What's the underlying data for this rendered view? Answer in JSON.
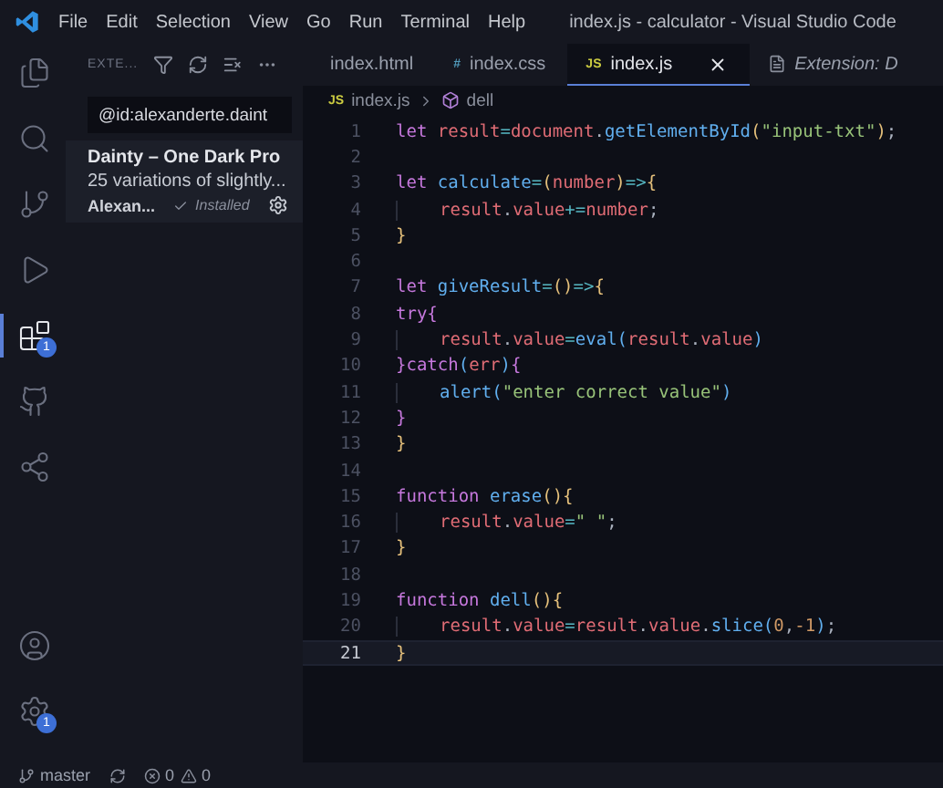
{
  "title_bar": {
    "menu": [
      "File",
      "Edit",
      "Selection",
      "View",
      "Go",
      "Run",
      "Terminal",
      "Help"
    ],
    "title": "index.js - calculator - Visual Studio Code"
  },
  "activity_bar": {
    "items": [
      {
        "kind": "files",
        "selected": false
      },
      {
        "kind": "search",
        "selected": false
      },
      {
        "kind": "source-control",
        "selected": false
      },
      {
        "kind": "run",
        "selected": false
      },
      {
        "kind": "extensions",
        "selected": true,
        "badge": "1"
      },
      {
        "kind": "github",
        "selected": false
      },
      {
        "kind": "remote",
        "selected": false
      }
    ],
    "bottom": [
      {
        "kind": "account"
      },
      {
        "kind": "settings",
        "badge": "1"
      }
    ]
  },
  "sidebar": {
    "header": "EXTE...",
    "search": {
      "value": "@id:alexanderte.daint"
    },
    "extension": {
      "name": "Dainty – One Dark Pro",
      "description": "25 variations of slightly...",
      "author": "Alexan...",
      "status": "Installed"
    }
  },
  "tabs": [
    {
      "label": "index.html",
      "kind": "html",
      "selected": false
    },
    {
      "label": "index.css",
      "kind": "css",
      "icon_text": "#",
      "selected": false
    },
    {
      "label": "index.js",
      "kind": "js",
      "icon_text": "JS",
      "selected": true
    },
    {
      "label": "Extension: D",
      "kind": "preview",
      "selected": false
    }
  ],
  "breadcrumb": {
    "icon_text": "JS",
    "file": "index.js",
    "symbol": "dell"
  },
  "code": [
    {
      "number": "1",
      "current": false,
      "tokens": [
        {
          "kind": "kw",
          "text": "let "
        },
        {
          "kind": "var",
          "text": "result"
        },
        {
          "kind": "op",
          "text": "="
        },
        {
          "kind": "var",
          "text": "document"
        },
        {
          "kind": "plain",
          "text": "."
        },
        {
          "kind": "fn",
          "text": "getElementById"
        },
        {
          "kind": "br",
          "text": "("
        },
        {
          "kind": "str",
          "text": "\"input-txt\""
        },
        {
          "kind": "br",
          "text": ")"
        },
        {
          "kind": "plain",
          "text": ";"
        }
      ]
    },
    {
      "number": "2",
      "current": false
    },
    {
      "number": "3",
      "current": false,
      "tokens": [
        {
          "kind": "kw",
          "text": "let "
        },
        {
          "kind": "fn",
          "text": "calculate"
        },
        {
          "kind": "op",
          "text": "="
        },
        {
          "kind": "br",
          "text": "("
        },
        {
          "kind": "var",
          "text": "number"
        },
        {
          "kind": "br",
          "text": ")"
        },
        {
          "kind": "op",
          "text": "=>"
        },
        {
          "kind": "br",
          "text": "{"
        }
      ]
    },
    {
      "number": "4",
      "indent": true,
      "current": false,
      "tokens": [
        {
          "kind": "var",
          "text": "result"
        },
        {
          "kind": "plain",
          "text": "."
        },
        {
          "kind": "var",
          "text": "value"
        },
        {
          "kind": "op",
          "text": "+="
        },
        {
          "kind": "var",
          "text": "number"
        },
        {
          "kind": "plain",
          "text": ";"
        }
      ]
    },
    {
      "number": "5",
      "current": false,
      "tokens": [
        {
          "kind": "br",
          "text": "}"
        }
      ]
    },
    {
      "number": "6",
      "current": false
    },
    {
      "number": "7",
      "current": false,
      "tokens": [
        {
          "kind": "kw",
          "text": "let "
        },
        {
          "kind": "fn",
          "text": "giveResult"
        },
        {
          "kind": "op",
          "text": "="
        },
        {
          "kind": "br",
          "text": "()"
        },
        {
          "kind": "op",
          "text": "=>"
        },
        {
          "kind": "br",
          "text": "{"
        }
      ]
    },
    {
      "number": "8",
      "current": false,
      "tokens": [
        {
          "kind": "kw",
          "text": "try"
        },
        {
          "kind": "br2",
          "text": "{"
        }
      ]
    },
    {
      "number": "9",
      "indent": true,
      "current": false,
      "tokens": [
        {
          "kind": "var",
          "text": "result"
        },
        {
          "kind": "plain",
          "text": "."
        },
        {
          "kind": "var",
          "text": "value"
        },
        {
          "kind": "op",
          "text": "="
        },
        {
          "kind": "fn",
          "text": "eval"
        },
        {
          "kind": "br3",
          "text": "("
        },
        {
          "kind": "var",
          "text": "result"
        },
        {
          "kind": "plain",
          "text": "."
        },
        {
          "kind": "var",
          "text": "value"
        },
        {
          "kind": "br3",
          "text": ")"
        }
      ]
    },
    {
      "number": "10",
      "current": false,
      "tokens": [
        {
          "kind": "br2",
          "text": "}"
        },
        {
          "kind": "kw",
          "text": "catch"
        },
        {
          "kind": "br3",
          "text": "("
        },
        {
          "kind": "var",
          "text": "err"
        },
        {
          "kind": "br3",
          "text": ")"
        },
        {
          "kind": "br2",
          "text": "{"
        }
      ]
    },
    {
      "number": "11",
      "indent": true,
      "current": false,
      "tokens": [
        {
          "kind": "fn",
          "text": "alert"
        },
        {
          "kind": "br3",
          "text": "("
        },
        {
          "kind": "str",
          "text": "\"enter correct value\""
        },
        {
          "kind": "br3",
          "text": ")"
        }
      ]
    },
    {
      "number": "12",
      "current": false,
      "tokens": [
        {
          "kind": "br2",
          "text": "}"
        }
      ]
    },
    {
      "number": "13",
      "current": false,
      "tokens": [
        {
          "kind": "br",
          "text": "}"
        }
      ]
    },
    {
      "number": "14",
      "current": false
    },
    {
      "number": "15",
      "current": false,
      "tokens": [
        {
          "kind": "kw",
          "text": "function "
        },
        {
          "kind": "fn",
          "text": "erase"
        },
        {
          "kind": "br",
          "text": "(){"
        }
      ]
    },
    {
      "number": "16",
      "indent": true,
      "current": false,
      "tokens": [
        {
          "kind": "var",
          "text": "result"
        },
        {
          "kind": "plain",
          "text": "."
        },
        {
          "kind": "var",
          "text": "value"
        },
        {
          "kind": "op",
          "text": "="
        },
        {
          "kind": "str",
          "text": "\" \""
        },
        {
          "kind": "plain",
          "text": ";"
        }
      ]
    },
    {
      "number": "17",
      "current": false,
      "tokens": [
        {
          "kind": "br",
          "text": "}"
        }
      ]
    },
    {
      "number": "18",
      "current": false
    },
    {
      "number": "19",
      "current": false,
      "tokens": [
        {
          "kind": "kw",
          "text": "function "
        },
        {
          "kind": "fn",
          "text": "dell"
        },
        {
          "kind": "br",
          "text": "(){"
        }
      ]
    },
    {
      "number": "20",
      "indent": true,
      "current": false,
      "tokens": [
        {
          "kind": "var",
          "text": "result"
        },
        {
          "kind": "plain",
          "text": "."
        },
        {
          "kind": "var",
          "text": "value"
        },
        {
          "kind": "op",
          "text": "="
        },
        {
          "kind": "var",
          "text": "result"
        },
        {
          "kind": "plain",
          "text": "."
        },
        {
          "kind": "var",
          "text": "value"
        },
        {
          "kind": "plain",
          "text": "."
        },
        {
          "kind": "fn",
          "text": "slice"
        },
        {
          "kind": "br3",
          "text": "("
        },
        {
          "kind": "num",
          "text": "0"
        },
        {
          "kind": "plain",
          "text": ","
        },
        {
          "kind": "num",
          "text": "-1"
        },
        {
          "kind": "br3",
          "text": ")"
        },
        {
          "kind": "plain",
          "text": ";"
        }
      ]
    },
    {
      "number": "21",
      "current": true,
      "tokens": [
        {
          "kind": "br",
          "text": "}"
        }
      ]
    }
  ],
  "status_bar": {
    "branch": "master",
    "errors": "0",
    "warnings": "0"
  }
}
